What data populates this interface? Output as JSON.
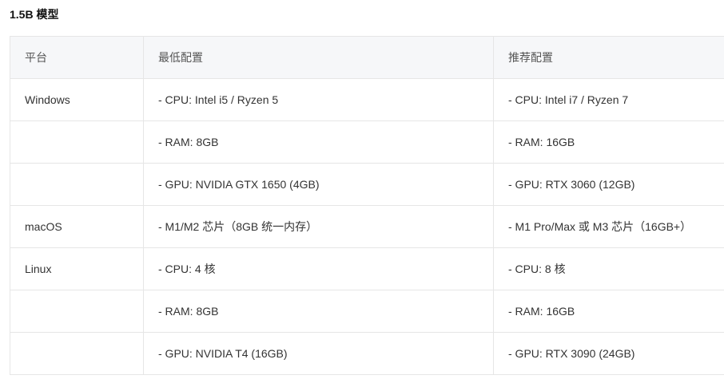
{
  "heading": "1.5B 模型",
  "table": {
    "headers": [
      "平台",
      "最低配置",
      "推荐配置"
    ],
    "rows": [
      [
        "Windows",
        "- CPU: Intel i5 / Ryzen 5",
        "- CPU: Intel i7 / Ryzen 7"
      ],
      [
        "",
        "- RAM: 8GB",
        "- RAM: 16GB"
      ],
      [
        "",
        "- GPU: NVIDIA GTX 1650 (4GB)",
        "- GPU: RTX 3060 (12GB)"
      ],
      [
        "macOS",
        "- M1/M2 芯片（8GB 统一内存）",
        "- M1 Pro/Max 或 M3 芯片（16GB+）"
      ],
      [
        "Linux",
        "- CPU: 4 核",
        "- CPU: 8 核"
      ],
      [
        "",
        "- RAM: 8GB",
        "- RAM: 16GB"
      ],
      [
        "",
        "- GPU: NVIDIA T4 (16GB)",
        "- GPU: RTX 3090 (24GB)"
      ]
    ]
  }
}
